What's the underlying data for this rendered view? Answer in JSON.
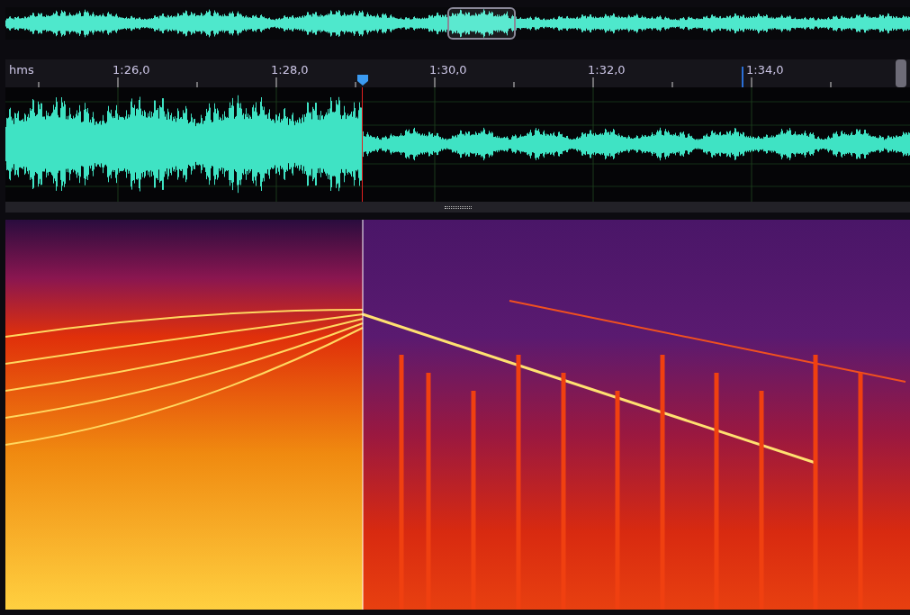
{
  "ruler": {
    "unit": "hms",
    "labels": [
      "1:26,0",
      "1:28,0",
      "1:30,0",
      "1:32,0",
      "1:34,0"
    ]
  }
}
